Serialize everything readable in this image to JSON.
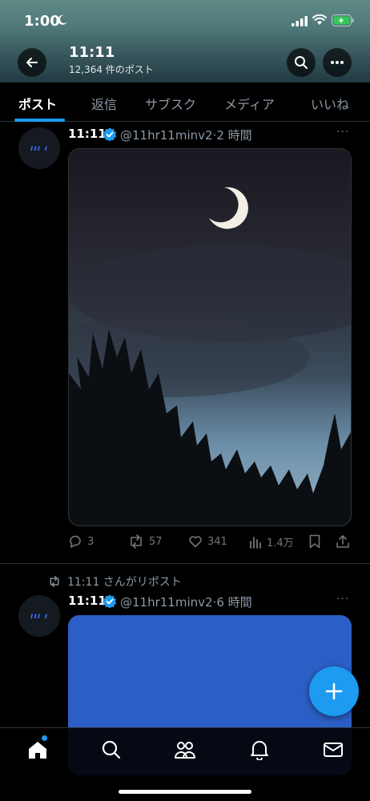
{
  "status_bar": {
    "time": "1:00",
    "battery_icon": "battery-charging-icon"
  },
  "header": {
    "title": "11:11",
    "post_count": "12,364 件のポスト",
    "back_icon": "back-arrow-icon",
    "search_icon": "search-icon",
    "more_icon": "more-icon"
  },
  "tabs": [
    {
      "label": "ポスト",
      "active": true
    },
    {
      "label": "返信",
      "active": false
    },
    {
      "label": "サブスク",
      "active": false
    },
    {
      "label": "メディア",
      "active": false
    },
    {
      "label": "いいね",
      "active": false
    }
  ],
  "posts": [
    {
      "avatar_text": "ııı ı",
      "name": "11:11",
      "handle": "@11hr11minv2",
      "time": "2 時間",
      "more": "···",
      "replies": "3",
      "reposts": "57",
      "likes": "341",
      "views": "1.4万"
    },
    {
      "repost_label": "11:11 さんがリポスト",
      "avatar_text": "ııı ı",
      "name": "11:11",
      "handle": "@11hr11minv2",
      "time": "6 時間",
      "more": "···"
    }
  ],
  "colors": {
    "accent": "#1d9bf0",
    "background": "#000000",
    "text": "#e7e9ea",
    "muted": "#8b98a5"
  }
}
